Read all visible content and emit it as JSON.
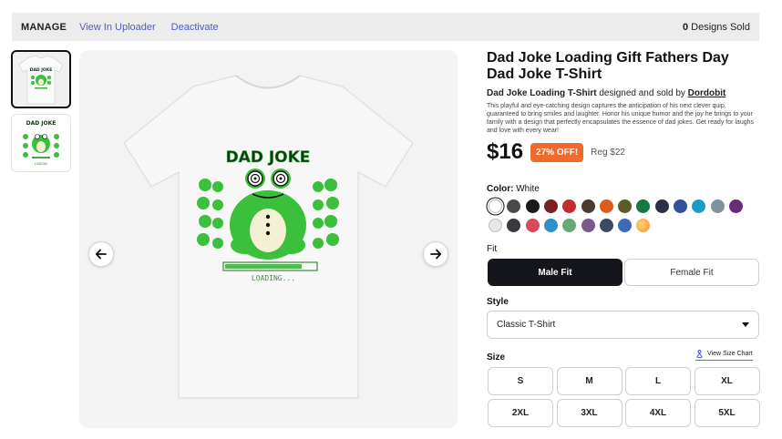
{
  "manage_bar": {
    "manage": "MANAGE",
    "view_uploader": "View In Uploader",
    "deactivate": "Deactivate",
    "sold_count": "0",
    "sold_text": "Designs Sold"
  },
  "product": {
    "title": "Dad Joke Loading Gift Fathers Day Dad Joke T-Shirt",
    "design_name": "Dad Joke Loading T-Shirt",
    "designed_by": "designed and sold by",
    "artist": "Dordobit",
    "description": "This playful and eye-catching design captures the anticipation of his next clever quip, guaranteed to bring smiles and laughter. Honor his unique humor and the joy he brings to your family with a design that perfectly encapsulates the essence of dad jokes. Get ready for laughs and love with every wear!",
    "price": "$16",
    "discount": "27% OFF!",
    "regular_price": "Reg $22"
  },
  "artwork": {
    "heading": "DAD JOKE",
    "loading": "LOADING..."
  },
  "thumb2": {
    "heading": "DAD JOKE",
    "loading": "LOADING"
  },
  "color": {
    "label": "Color:",
    "selected": "White",
    "swatches_row1": [
      "#ffffff",
      "#4a4a4a",
      "#1a1a1a",
      "#7a1f22",
      "#c62b32",
      "#4a3a30",
      "#e05a1e",
      "#5d5a2a",
      "#137a43",
      "#2a3047",
      "#34509a",
      "#1a9cc7",
      "#7f939f",
      "#6a2c7a"
    ],
    "swatches_row2": [
      "#e6e6e6",
      "#3a3a3e",
      "#d64a5a",
      "#2e8fc9",
      "#6aaa72",
      "#7a5a8a",
      "#3c4a66",
      "#3a6ab8",
      "#f2a24a"
    ]
  },
  "fit": {
    "label": "Fit",
    "male": "Male Fit",
    "female": "Female Fit"
  },
  "style": {
    "label": "Style",
    "selected": "Classic T-Shirt"
  },
  "size": {
    "label": "Size",
    "chart_link": "View Size Chart",
    "options": [
      "S",
      "M",
      "L",
      "XL",
      "2XL",
      "3XL",
      "4XL",
      "5XL"
    ]
  }
}
